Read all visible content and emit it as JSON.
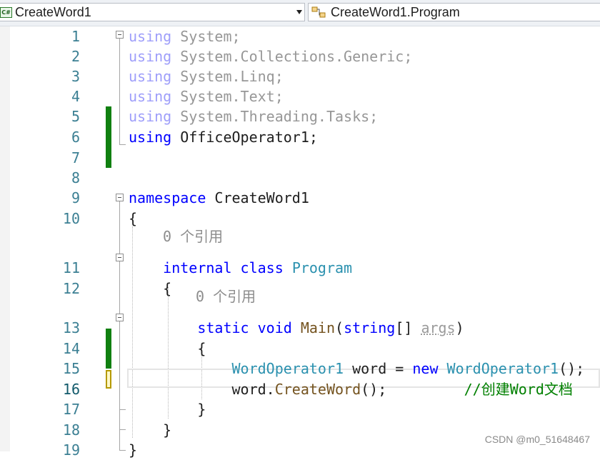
{
  "navbar": {
    "project_combo": {
      "label": "CreateWord1",
      "icon": "csharp-project-icon"
    },
    "type_combo": {
      "label": "CreateWord1.Program",
      "icon": "class-icon"
    }
  },
  "editor": {
    "lines": [
      {
        "n": "1",
        "parts": [
          {
            "t": "using",
            "c": "kw-dim"
          },
          {
            "t": " System;",
            "c": "dim"
          }
        ]
      },
      {
        "n": "2",
        "parts": [
          {
            "t": "using",
            "c": "kw-dim"
          },
          {
            "t": " System.Collections.Generic;",
            "c": "dim"
          }
        ]
      },
      {
        "n": "3",
        "parts": [
          {
            "t": "using",
            "c": "kw-dim"
          },
          {
            "t": " System.Linq;",
            "c": "dim"
          }
        ]
      },
      {
        "n": "4",
        "parts": [
          {
            "t": "using",
            "c": "kw-dim"
          },
          {
            "t": " System.Text;",
            "c": "dim"
          }
        ]
      },
      {
        "n": "5",
        "parts": [
          {
            "t": "using",
            "c": "kw-dim"
          },
          {
            "t": " System.Threading.Tasks;",
            "c": "dim"
          }
        ]
      },
      {
        "n": "6",
        "parts": [
          {
            "t": "using",
            "c": "kw"
          },
          {
            "t": " OfficeOperator1;",
            "c": ""
          }
        ]
      },
      {
        "n": "7",
        "parts": []
      },
      {
        "n": "8",
        "parts": []
      },
      {
        "n": "9",
        "parts": [
          {
            "t": "namespace",
            "c": "kw"
          },
          {
            "t": " CreateWord1",
            "c": ""
          }
        ]
      },
      {
        "n": "10",
        "parts": [
          {
            "t": "{",
            "c": ""
          }
        ]
      },
      {
        "n": "11",
        "parts": [
          {
            "t": "    internal",
            "c": "kw"
          },
          {
            "t": " ",
            "c": ""
          },
          {
            "t": "class",
            "c": "kw"
          },
          {
            "t": " ",
            "c": ""
          },
          {
            "t": "Program",
            "c": "type"
          }
        ]
      },
      {
        "n": "12",
        "parts": [
          {
            "t": "    {",
            "c": ""
          }
        ]
      },
      {
        "n": "13",
        "parts": [
          {
            "t": "        static",
            "c": "kw"
          },
          {
            "t": " ",
            "c": ""
          },
          {
            "t": "void",
            "c": "kw"
          },
          {
            "t": " ",
            "c": ""
          },
          {
            "t": "Main",
            "c": "method"
          },
          {
            "t": "(",
            "c": ""
          },
          {
            "t": "string",
            "c": "kw"
          },
          {
            "t": "[] ",
            "c": ""
          },
          {
            "t": "args",
            "c": "param-unused"
          },
          {
            "t": ")",
            "c": ""
          }
        ]
      },
      {
        "n": "14",
        "parts": [
          {
            "t": "        {",
            "c": ""
          }
        ]
      },
      {
        "n": "15",
        "parts": [
          {
            "t": "            ",
            "c": ""
          },
          {
            "t": "WordOperator1",
            "c": "type"
          },
          {
            "t": " word = ",
            "c": ""
          },
          {
            "t": "new",
            "c": "kw"
          },
          {
            "t": " ",
            "c": ""
          },
          {
            "t": "WordOperator1",
            "c": "type"
          },
          {
            "t": "();",
            "c": ""
          }
        ]
      },
      {
        "n": "16",
        "parts": [
          {
            "t": "            word.",
            "c": ""
          },
          {
            "t": "CreateWord",
            "c": "method"
          },
          {
            "t": "();         ",
            "c": ""
          },
          {
            "t": "//创建Word文档",
            "c": "comment"
          }
        ]
      },
      {
        "n": "17",
        "parts": [
          {
            "t": "        }",
            "c": ""
          }
        ]
      },
      {
        "n": "18",
        "parts": [
          {
            "t": "    }",
            "c": ""
          }
        ]
      },
      {
        "n": "19",
        "parts": [
          {
            "t": "}",
            "c": ""
          }
        ]
      }
    ],
    "codelens": [
      "0 个引用",
      "0 个引用"
    ]
  },
  "watermark": "CSDN @m0_51648467"
}
